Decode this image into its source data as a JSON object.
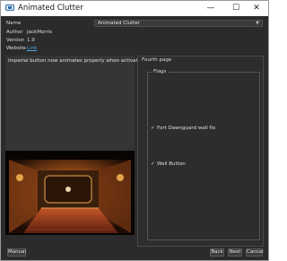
{
  "window": {
    "title": "Animated Clutter",
    "icon": "app-window-icon",
    "controls": {
      "minimize": "—",
      "maximize": "☐",
      "close": "✕"
    }
  },
  "info": {
    "name_label": "Name",
    "name_value": "Animated Clutter",
    "author_label": "Author",
    "author_value": "JackMorris",
    "version_label": "Version",
    "version_value": "1.9",
    "website_label": "Website",
    "website_link": "Link"
  },
  "description": "Imperial button now animates properly when activated",
  "preview_image": "in-game screenshot of an ornate lit chamber (preview)",
  "page": {
    "title": "Fourth page",
    "group_title": "Flags",
    "options": [
      {
        "label": "Fort Dawnguard wall fix",
        "checked": true,
        "mark": "✓"
      },
      {
        "label": "Wall Button",
        "checked": true,
        "mark": "✓"
      }
    ]
  },
  "buttons": {
    "manual": "Manual",
    "back": "Back",
    "next": "Next",
    "cancel": "Cancel"
  },
  "colors": {
    "background": "#2b2b2b",
    "link": "#4aa3df",
    "text": "#dcdcdc"
  }
}
